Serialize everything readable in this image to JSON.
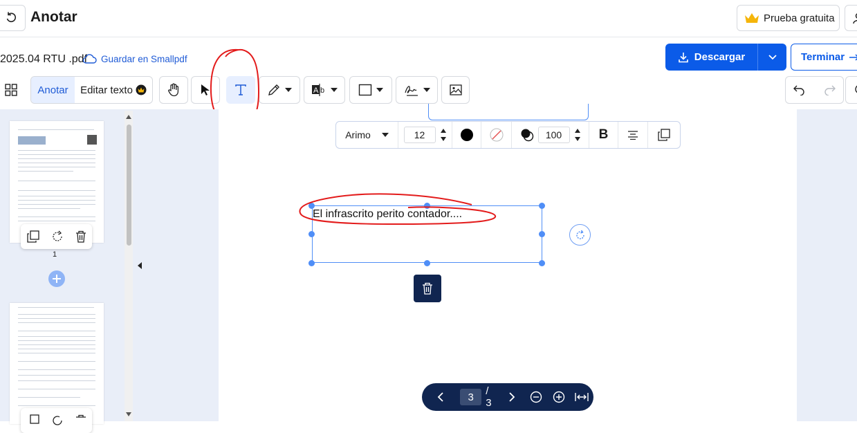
{
  "header": {
    "title": "Anotar",
    "trial_label": "Prueba gratuita"
  },
  "file": {
    "name": "2025.04 RTU .pdf",
    "save_label": "Guardar en Smallpdf"
  },
  "actions": {
    "download_label": "Descargar",
    "finish_label": "Terminar"
  },
  "modes": {
    "annotate_label": "Anotar",
    "edit_text_label": "Editar texto"
  },
  "icons": {
    "back": "undo-arrow-icon",
    "user": "user-icon",
    "crown": "crown-icon",
    "cloud": "cloud-icon",
    "grid": "grid-icon",
    "hand": "hand-icon",
    "select": "cursor-icon",
    "text": "text-icon",
    "pen": "pen-icon",
    "textfield": "text-field-icon",
    "shape": "rectangle-icon",
    "signature": "signature-icon",
    "image": "image-icon"
  },
  "format": {
    "font": "Arimo",
    "size": "12",
    "opacity": "100",
    "text_color": "#000000"
  },
  "annotation": {
    "text": "El infrascrito perito contador...."
  },
  "thumbnails": [
    {
      "page_label": "1"
    }
  ],
  "pager": {
    "current": "3",
    "total": "/ 3"
  },
  "colors": {
    "accent": "#0b5be8",
    "navy": "#102550",
    "selection": "#4f8ef7",
    "highlight_marker": "#e31b1b",
    "sidebar_bg": "#e9eef8"
  }
}
